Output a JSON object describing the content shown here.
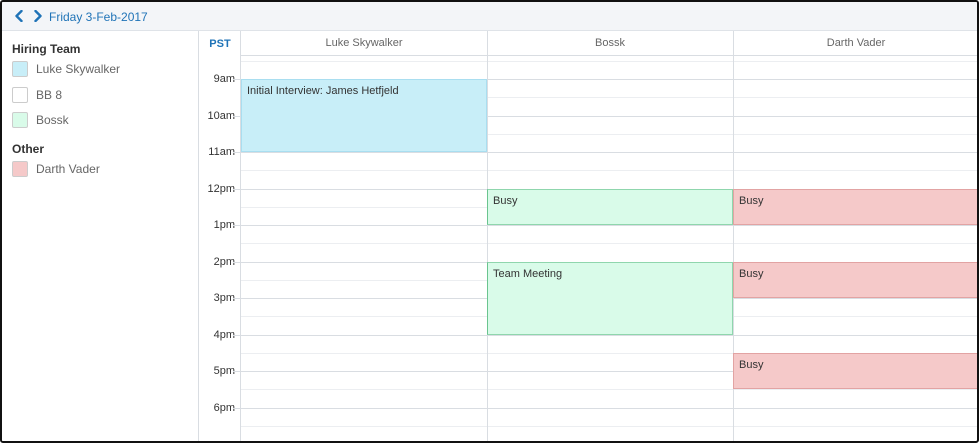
{
  "header": {
    "date": "Friday 3-Feb-2017",
    "prev_icon": "chevron-left-icon",
    "next_icon": "chevron-right-icon",
    "accent_color": "#1f73b7"
  },
  "sidebar": {
    "groups": [
      {
        "title": "Hiring Team",
        "members": [
          {
            "name": "Luke Skywalker",
            "color": "#c8eef8"
          },
          {
            "name": "BB 8",
            "color": "#ffffff"
          },
          {
            "name": "Bossk",
            "color": "#d9fbe9"
          }
        ]
      },
      {
        "title": "Other",
        "members": [
          {
            "name": "Darth Vader",
            "color": "#f5c9c9"
          }
        ]
      }
    ]
  },
  "calendar": {
    "timezone": "PST",
    "columns": [
      "Luke Skywalker",
      "Bossk",
      "Darth Vader"
    ],
    "hours": [
      "9am",
      "10am",
      "11am",
      "12pm",
      "1pm",
      "2pm",
      "3pm",
      "4pm",
      "5pm",
      "6pm"
    ],
    "events": [
      {
        "column": 0,
        "title": "Initial Interview: James Hetfjeld",
        "start": 9,
        "end": 11,
        "color": "blue"
      },
      {
        "column": 1,
        "title": "Busy",
        "start": 12,
        "end": 13,
        "color": "green"
      },
      {
        "column": 1,
        "title": "Team Meeting",
        "start": 14,
        "end": 16,
        "color": "green"
      },
      {
        "column": 2,
        "title": "Busy",
        "start": 12,
        "end": 13,
        "color": "red"
      },
      {
        "column": 2,
        "title": "Busy",
        "start": 14,
        "end": 15,
        "color": "red"
      },
      {
        "column": 2,
        "title": "Busy",
        "start": 16.5,
        "end": 17.5,
        "color": "red"
      }
    ]
  }
}
